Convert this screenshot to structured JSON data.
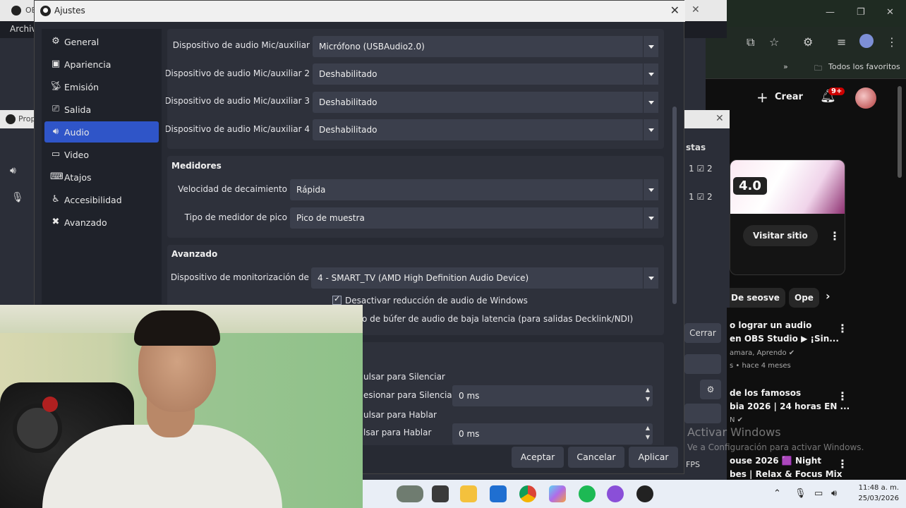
{
  "obs_main": {
    "title": "OBS",
    "menu": "Archivo"
  },
  "obs_props": {
    "title": "Prop",
    "mixer_header": "stas",
    "cerrar": "Cerrar",
    "fps": "FPS"
  },
  "dialog": {
    "title": "Ajustes",
    "sidebar": [
      {
        "label": "General",
        "icon": "gear-icon"
      },
      {
        "label": "Apariencia",
        "icon": "palette-icon"
      },
      {
        "label": "Emisión",
        "icon": "broadcast-icon"
      },
      {
        "label": "Salida",
        "icon": "output-icon"
      },
      {
        "label": "Audio",
        "icon": "speaker-icon",
        "active": true
      },
      {
        "label": "Video",
        "icon": "monitor-icon"
      },
      {
        "label": "Atajos",
        "icon": "keyboard-icon"
      },
      {
        "label": "Accesibilidad",
        "icon": "accessibility-icon"
      },
      {
        "label": "Avanzado",
        "icon": "wrench-icon"
      }
    ],
    "devices": [
      {
        "label": "Dispositivo de audio Mic/auxiliar",
        "value": "Micrófono (USBAudio2.0)"
      },
      {
        "label": "Dispositivo de audio Mic/auxiliar 2",
        "value": "Deshabilitado"
      },
      {
        "label": "Dispositivo de audio Mic/auxiliar 3",
        "value": "Deshabilitado"
      },
      {
        "label": "Dispositivo de audio Mic/auxiliar 4",
        "value": "Deshabilitado"
      }
    ],
    "medidores": {
      "title": "Medidores",
      "decay_label": "Velocidad de decaimiento",
      "decay_value": "Rápida",
      "peak_label": "Tipo de medidor de pico",
      "peak_value": "Pico de muestra"
    },
    "avanzado": {
      "title": "Avanzado",
      "monitor_label": "Dispositivo de monitorización de audio",
      "monitor_value": "4 - SMART_TV (AMD High Definition Audio Device)",
      "check1": "Desactivar reducción de audio de Windows",
      "check2": "o de búfer de audio de baja latencia (para salidas Decklink/NDI)"
    },
    "hotkeys": {
      "mute": "ulsar para Silenciar",
      "mute_delay_label": "esionar para Silenciar",
      "mute_delay_value": "0 ms",
      "ptt": "ulsar para Hablar",
      "ptt_delay_label": "lsar para Hablar",
      "ptt_delay_value": "0 ms"
    },
    "buttons": {
      "accept": "Aceptar",
      "cancel": "Cancelar",
      "apply": "Aplicar"
    }
  },
  "chrome": {
    "bookmarks_all": "Todos los favoritos",
    "create": "Crear",
    "notif_badge": "9+",
    "card_label": "4.0",
    "visit": "Visitar sitio",
    "chip1": "De seosve",
    "chip2": "Ope",
    "items": [
      {
        "title1": "o lograr un audio",
        "title2": "en OBS Studio ▶ ¡Sin...",
        "meta1": "amara, Aprendo ✔",
        "meta2": "s • hace 4 meses"
      },
      {
        "title1": "de los famosos",
        "title2": "bia 2026 | 24 horas EN ...",
        "meta1": "N ✔",
        "meta2": ""
      },
      {
        "title1": "ouse 2026 🟪 Night",
        "title2": "bes | Relax & Focus Mix",
        "meta1": "",
        "meta2": ""
      }
    ]
  },
  "watermark": {
    "line1": "Activar Windows",
    "line2": "Ve a Configuración para activar Windows."
  },
  "taskbar": {
    "time": "11:48 a. m.",
    "date": "25/03/2026"
  }
}
